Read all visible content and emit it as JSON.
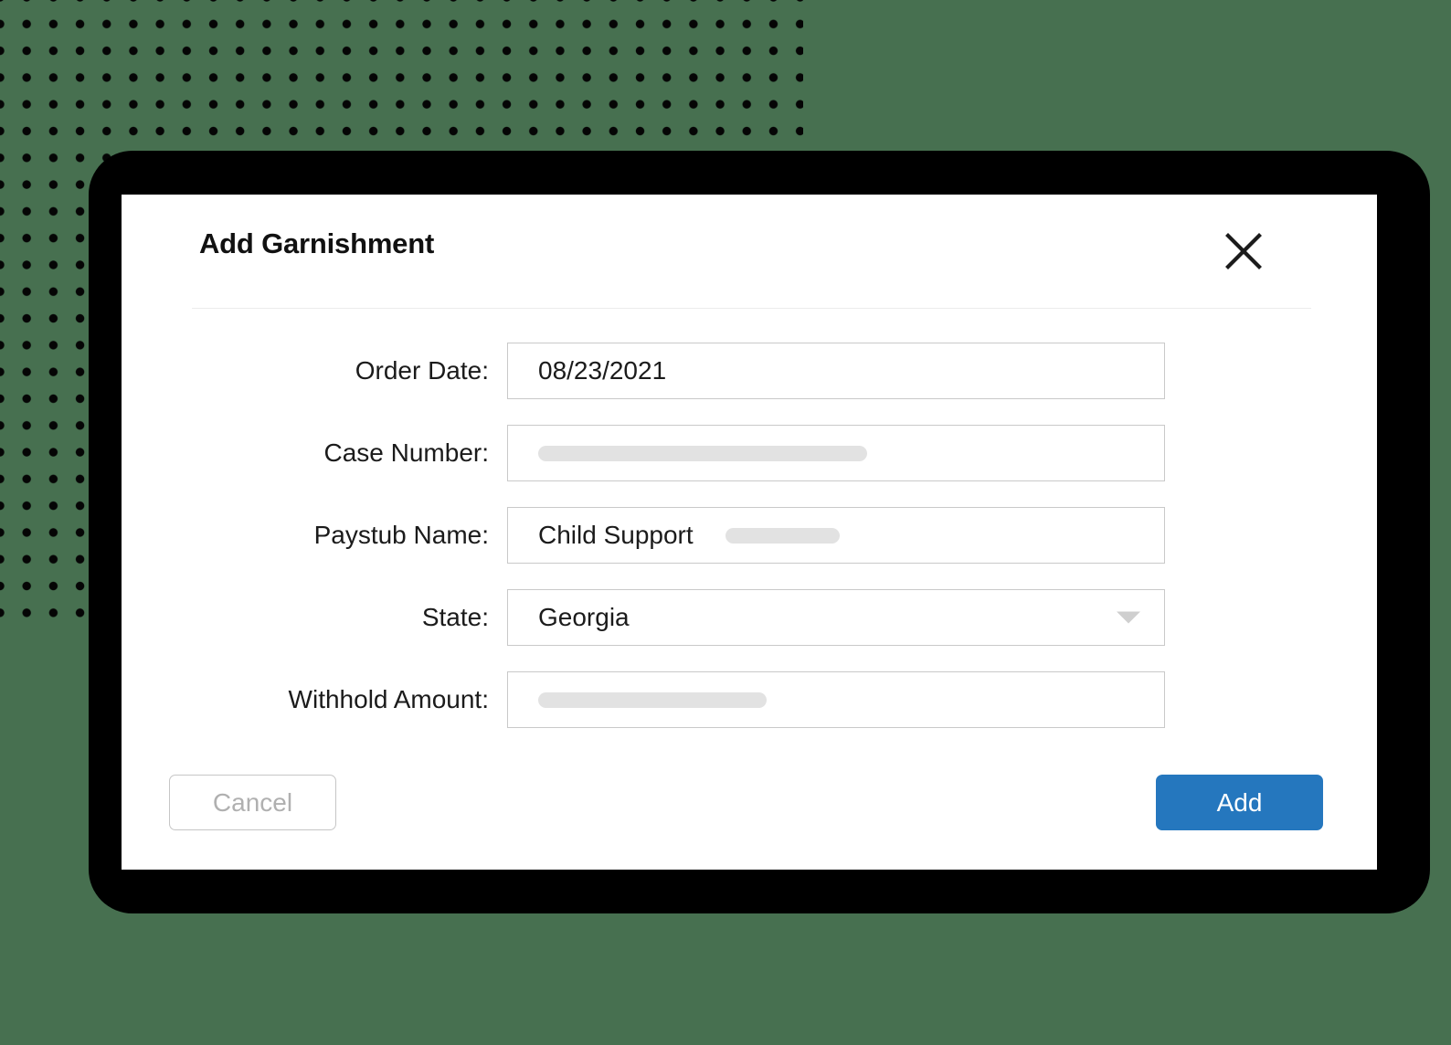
{
  "background": {
    "color": "#477050",
    "dot_color": "#050505",
    "pattern_name": "dot-grid"
  },
  "modal": {
    "frame_color": "#000000",
    "surface_color": "#ffffff",
    "title": "Add Garnishment",
    "close_icon": "close-icon",
    "fields": [
      {
        "label": "Order Date:",
        "type": "text",
        "value": "08/23/2021",
        "redacted": false
      },
      {
        "label": "Case Number:",
        "type": "text",
        "value": "",
        "redacted": true,
        "redaction": "long"
      },
      {
        "label": "Paystub Name:",
        "type": "text",
        "value": "Child Support",
        "redacted": true,
        "redaction": "short"
      },
      {
        "label": "State:",
        "type": "select",
        "value": "Georgia",
        "redacted": false,
        "caret_icon": "chevron-down-icon"
      },
      {
        "label": "Withhold Amount:",
        "type": "text",
        "value": "",
        "redacted": true,
        "redaction": "medium"
      }
    ],
    "footer": {
      "cancel_label": "Cancel",
      "add_label": "Add",
      "add_color": "#2577be",
      "cancel_text_color": "#b0b0b0"
    }
  }
}
